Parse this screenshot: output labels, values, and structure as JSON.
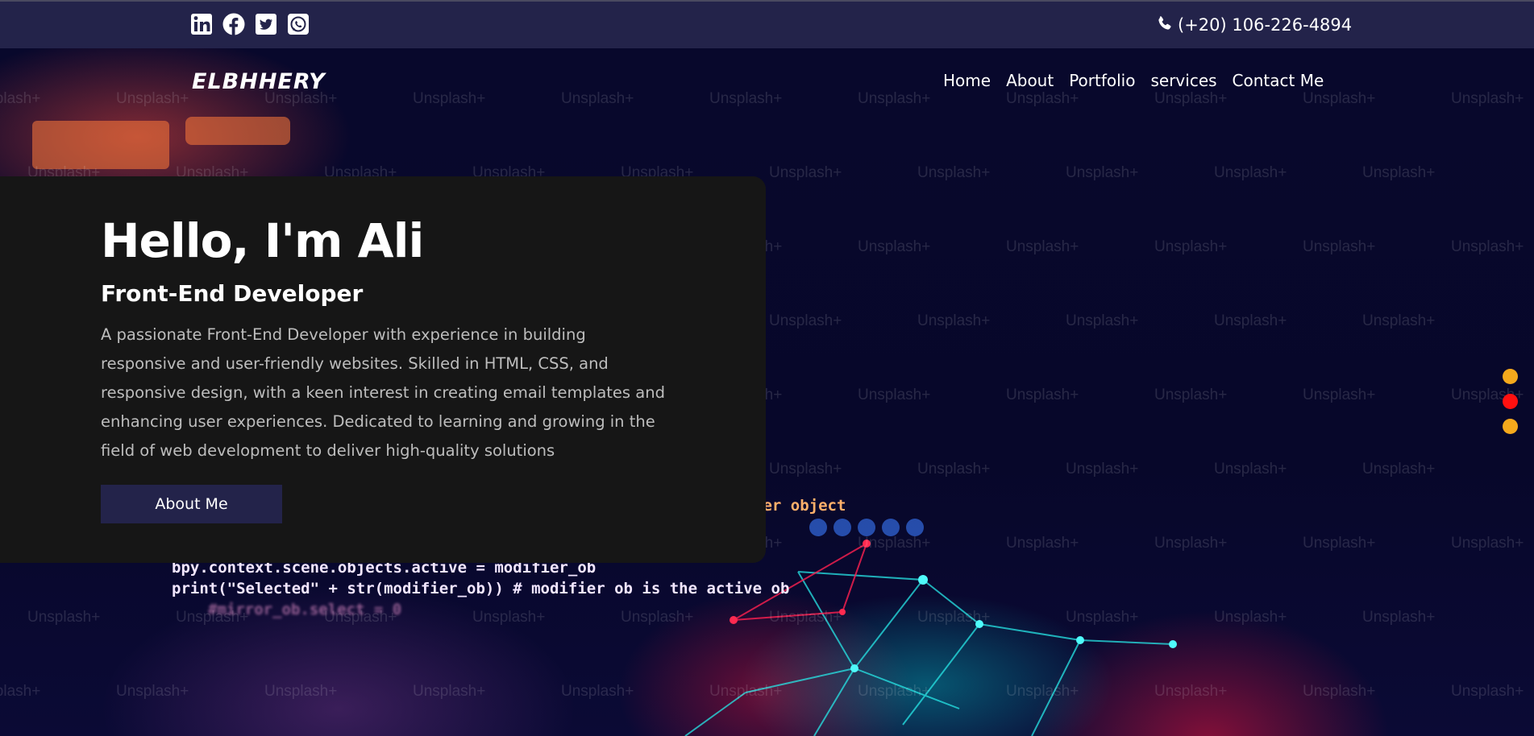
{
  "topbar": {
    "socials": [
      {
        "icon": "linkedin-icon",
        "name": "linkedin"
      },
      {
        "icon": "facebook-icon",
        "name": "facebook"
      },
      {
        "icon": "twitter-icon",
        "name": "twitter"
      },
      {
        "icon": "whatsapp-icon",
        "name": "whatsapp"
      }
    ],
    "phone_icon": "phone-icon",
    "phone": "(+20) 106-226-4894"
  },
  "header": {
    "logo": "ELBHHERY",
    "nav": [
      "Home",
      "About",
      "Portfolio",
      "services",
      "Contact Me"
    ]
  },
  "hero": {
    "title": "Hello, I'm Ali",
    "subtitle": "Front-End Developer",
    "description": "A passionate Front-End Developer with experience in building responsive and user-friendly websites. Skilled in HTML, CSS, and responsive design, with a keen interest in creating email templates and enhancing user experiences. Dedicated to learning and growing in the field of web development to deliver high-quality solutions",
    "button": "About Me"
  },
  "background": {
    "watermark_text": "Unsplash+",
    "code_lines": [
      "ier object",
      "bpy.context.scene.objects.active = modifier_ob",
      "print(\"Selected\" + str(modifier_ob)) # modifier ob is the active ob",
      "#mirror_ob.select = 0"
    ]
  },
  "slider_dots": [
    {
      "color": "#f5a91c",
      "active": false
    },
    {
      "color": "#ff1010",
      "active": true
    },
    {
      "color": "#f5a91c",
      "active": false
    }
  ],
  "colors": {
    "topbar": "#23234a",
    "card": "#161616",
    "button": "#23234a",
    "accent_dot": "#f5a91c",
    "active_dot": "#ff1010"
  }
}
